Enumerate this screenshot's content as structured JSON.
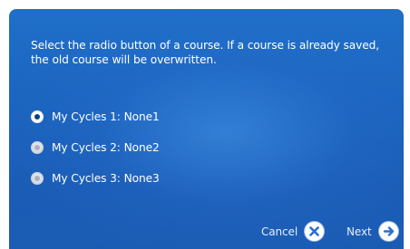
{
  "dialog": {
    "instruction": "Select the radio button of a course. If a course is already saved, the old course will be overwritten.",
    "options": [
      {
        "label": "My Cycles 1: None1",
        "selected": true
      },
      {
        "label": "My Cycles 2: None2",
        "selected": false
      },
      {
        "label": "My Cycles 3: None3",
        "selected": false
      }
    ],
    "cancel_label": "Cancel",
    "next_label": "Next"
  },
  "colors": {
    "background_top": "#1f6fc8",
    "background_bottom": "#1b5cb3",
    "icon_blue": "#2a6fd0",
    "text": "#ffffff"
  },
  "icons": {
    "cancel": "close-icon",
    "next": "arrow-right-icon"
  }
}
